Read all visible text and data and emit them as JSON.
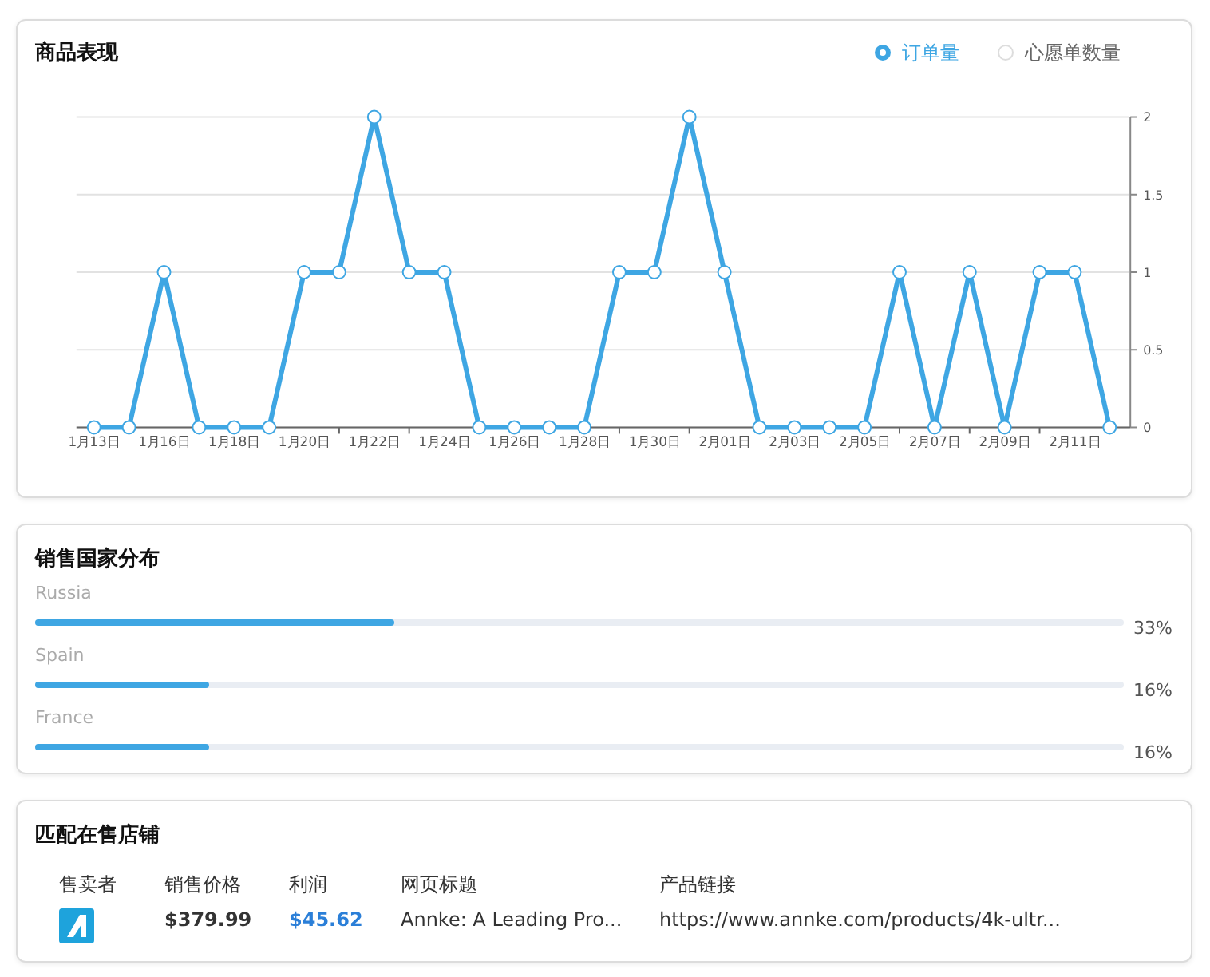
{
  "performance": {
    "title": "商品表现",
    "legend": [
      {
        "selected": true
      },
      {
        "label": "心愿单数量",
        "selected": false
      }
    ],
    "chart_data": {
      "type": "line",
      "categories": [
        "1月13日",
        null,
        "1月16日",
        null,
        "1月18日",
        null,
        "1月20日",
        null,
        "1月22日",
        null,
        "1月24日",
        null,
        "1月26日",
        null,
        "1月28日",
        null,
        "1月30日",
        null,
        "2月01日",
        null,
        "2月03日",
        null,
        "2月05日",
        null,
        "2月07日",
        null,
        "2月09日",
        null,
        "2月11日",
        null
      ],
      "grid": true,
      "series": [
        {
          "name": "订单量",
          "color": "#3ea6e3",
          "marker": "circle",
          "values": [
            0,
            0,
            1,
            0,
            0,
            0,
            1,
            1,
            2,
            1,
            1,
            0,
            0,
            0,
            0,
            1,
            1,
            2,
            1,
            0,
            0,
            0,
            0,
            1,
            0,
            1,
            0,
            1,
            1,
            0
          ]
        }
      ],
      "yticks": [
        0,
        0.5,
        1,
        1.5,
        2
      ],
      "ylim": [
        0,
        2
      ]
    }
  },
  "countries": {
    "title": "销售国家分布",
    "items": [
      {
        "name": "Russia",
        "level": 0.33,
        "reading": "33%"
      },
      {
        "name": "Spain",
        "level": 0.16,
        "reading": "16%"
      },
      {
        "name": "France",
        "level": 0.16,
        "reading": "16%"
      }
    ]
  },
  "stores": {
    "title": "匹配在售店铺",
    "columns": [
      "售卖者",
      "销售价格",
      "利润",
      "网页标题",
      "产品链接"
    ],
    "rows": [
      {
        "price": "$379.99",
        "profit": "$45.62",
        "page_title": "Annke: A Leading Pro...",
        "link": "https://www.annke.com/products/4k-ultr..."
      }
    ]
  }
}
